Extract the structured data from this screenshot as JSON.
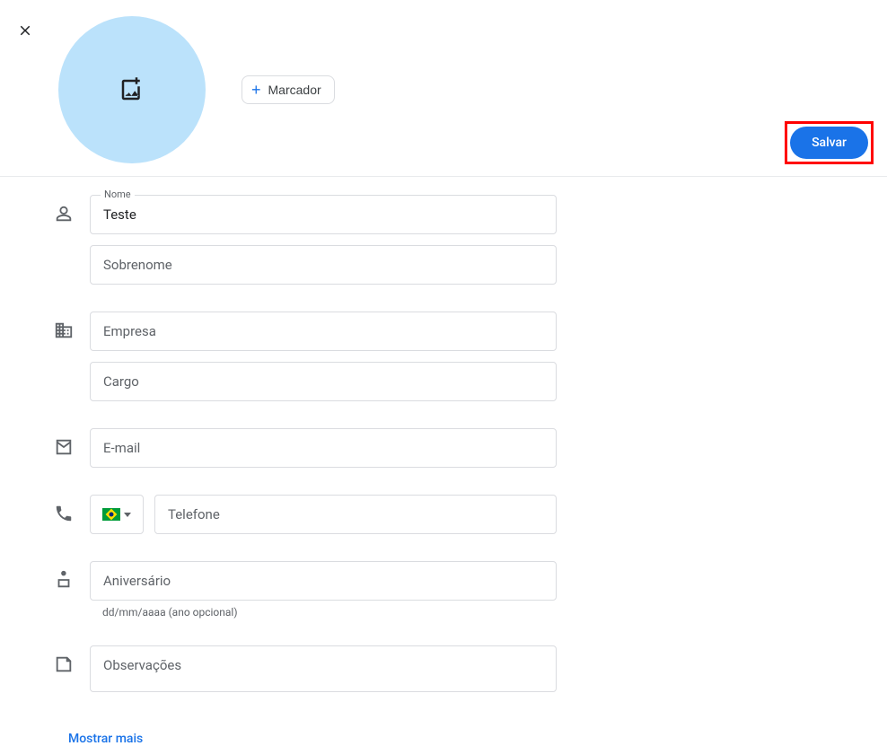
{
  "close_label": "Close",
  "marker": {
    "label": "Marcador"
  },
  "save_label": "Salvar",
  "form": {
    "name": {
      "label": "Nome",
      "value": "Teste"
    },
    "surname_placeholder": "Sobrenome",
    "company_placeholder": "Empresa",
    "jobtitle_placeholder": "Cargo",
    "email_placeholder": "E-mail",
    "phone": {
      "country_code": "BR",
      "placeholder": "Telefone"
    },
    "birthday": {
      "placeholder": "Aniversário",
      "helper": "dd/mm/aaaa (ano opcional)"
    },
    "notes_placeholder": "Observações"
  },
  "show_more": "Mostrar mais"
}
